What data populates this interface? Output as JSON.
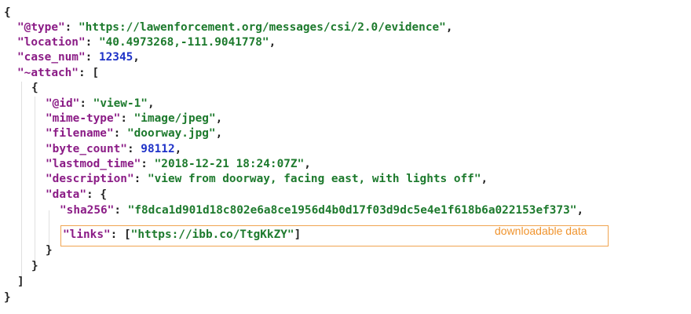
{
  "document": {
    "open_brace": "{",
    "close_brace": "}",
    "open_bracket": "[",
    "close_bracket": "]",
    "type_key": "\"@type\"",
    "type_value": "\"https://lawenforcement.org/messages/csi/2.0/evidence\"",
    "location_key": "\"location\"",
    "location_value": "\"40.4973268,-111.9041778\"",
    "case_num_key": "\"case_num\"",
    "case_num_value": "12345",
    "attach_key": "\"~attach\"",
    "attachment": {
      "id_key": "\"@id\"",
      "id_value": "\"view-1\"",
      "mime_key": "\"mime-type\"",
      "mime_value": "\"image/jpeg\"",
      "filename_key": "\"filename\"",
      "filename_value": "\"doorway.jpg\"",
      "byte_count_key": "\"byte_count\"",
      "byte_count_value": "98112",
      "lastmod_key": "\"lastmod_time\"",
      "lastmod_value": "\"2018-12-21 18:24:07Z\"",
      "description_key": "\"description\"",
      "description_value": "\"view from doorway, facing east, with lights off\"",
      "data_key": "\"data\"",
      "data": {
        "sha256_key": "\"sha256\"",
        "sha256_value": "\"f8dca1d901d18c802e6a8ce1956d4b0d17f03d9dc5e4e1f618b6a022153ef373\"",
        "links_key": "\"links\"",
        "links_value": "\"https://ibb.co/TtgKkZY\""
      }
    }
  },
  "annotation": {
    "label": "downloadable data",
    "color": "#f0942e"
  },
  "colors": {
    "key": "#8b1c86",
    "string": "#1d7a2d",
    "number": "#1f33c8"
  }
}
